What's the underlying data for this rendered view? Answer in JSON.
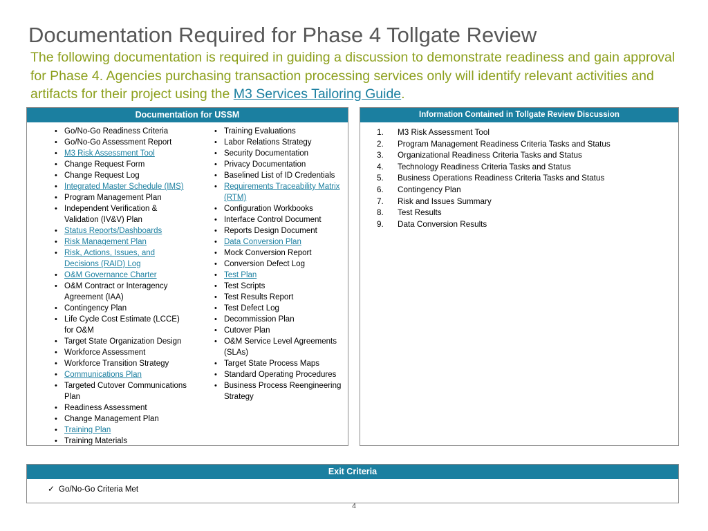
{
  "slide": {
    "title": "Documentation Required for Phase 4 Tollgate Review",
    "subtitle_part1": "The following documentation is required in guiding a discussion to demonstrate readiness and gain approval for Phase 4. Agencies purchasing transaction processing services only will identify relevant activities and artifacts for their project using the ",
    "subtitle_link": "M3 Services Tailoring Guide",
    "subtitle_part2": ".",
    "page_number": "4"
  },
  "left_panel": {
    "header": "Documentation for USSM",
    "column_a": [
      {
        "label": "Go/No-Go Readiness Criteria",
        "link": false
      },
      {
        "label": "Go/No-Go Assessment Report",
        "link": false
      },
      {
        "label": "M3 Risk Assessment Tool",
        "link": true
      },
      {
        "label": "Change Request Form",
        "link": false
      },
      {
        "label": "Change Request Log",
        "link": false
      },
      {
        "label": "Integrated Master Schedule (IMS)",
        "link": true
      },
      {
        "label": "Program Management Plan",
        "link": false
      },
      {
        "label": "Independent Verification & Validation (IV&V) Plan",
        "link": false
      },
      {
        "label": "Status Reports/Dashboards",
        "link": true
      },
      {
        "label": "Risk Management Plan",
        "link": true
      },
      {
        "label": "Risk, Actions, Issues, and Decisions (RAID) Log",
        "link": true
      },
      {
        "label": "O&M Governance Charter",
        "link": true
      },
      {
        "label": "O&M Contract or Interagency Agreement (IAA)",
        "link": false
      },
      {
        "label": "Contingency Plan",
        "link": false
      },
      {
        "label": "Life Cycle Cost Estimate (LCCE) for O&M",
        "link": false
      },
      {
        "label": "Target State Organization Design",
        "link": false
      },
      {
        "label": "Workforce Assessment",
        "link": false
      },
      {
        "label": "Workforce Transition Strategy",
        "link": false
      },
      {
        "label": "Communications Plan",
        "link": true
      },
      {
        "label": "Targeted Cutover Communications Plan",
        "link": false
      },
      {
        "label": "Readiness Assessment",
        "link": false
      },
      {
        "label": "Change Management Plan",
        "link": false
      },
      {
        "label": "Training Plan",
        "link": true
      },
      {
        "label": "Training Materials",
        "link": false
      }
    ],
    "column_b": [
      {
        "label": "Training Evaluations",
        "link": false
      },
      {
        "label": "Labor Relations Strategy",
        "link": false
      },
      {
        "label": "Security Documentation",
        "link": false
      },
      {
        "label": "Privacy Documentation",
        "link": false
      },
      {
        "label": "Baselined List of ID Credentials",
        "link": false
      },
      {
        "label": "Requirements Traceability Matrix (RTM)",
        "link": true
      },
      {
        "label": "Configuration Workbooks",
        "link": false
      },
      {
        "label": "Interface Control Document",
        "link": false
      },
      {
        "label": "Reports Design Document",
        "link": false
      },
      {
        "label": "Data Conversion Plan",
        "link": true
      },
      {
        "label": "Mock Conversion Report",
        "link": false
      },
      {
        "label": "Conversion Defect Log",
        "link": false
      },
      {
        "label": "Test Plan",
        "link": true
      },
      {
        "label": "Test Scripts",
        "link": false
      },
      {
        "label": "Test Results Report",
        "link": false
      },
      {
        "label": "Test Defect Log",
        "link": false
      },
      {
        "label": "Decommission Plan",
        "link": false
      },
      {
        "label": "Cutover Plan",
        "link": false
      },
      {
        "label": "O&M Service Level Agreements (SLAs)",
        "link": false
      },
      {
        "label": "Target State Process Maps",
        "link": false
      },
      {
        "label": "Standard Operating Procedures",
        "link": false
      },
      {
        "label": "Business Process Reengineering Strategy",
        "link": false
      }
    ]
  },
  "right_panel": {
    "header": "Information Contained in Tollgate Review Discussion",
    "items": [
      {
        "num": "1.",
        "label": "M3 Risk Assessment Tool"
      },
      {
        "num": "2.",
        "label": "Program Management Readiness Criteria Tasks and Status"
      },
      {
        "num": "3.",
        "label": "Organizational Readiness Criteria Tasks and Status"
      },
      {
        "num": "4.",
        "label": "Technology Readiness Criteria Tasks and Status"
      },
      {
        "num": "5.",
        "label": "Business Operations Readiness Criteria Tasks and Status"
      },
      {
        "num": "6.",
        "label": "Contingency Plan"
      },
      {
        "num": "7.",
        "label": "Risk and Issues Summary"
      },
      {
        "num": "8.",
        "label": "Test Results"
      },
      {
        "num": "9.",
        "label": "Data Conversion Results"
      }
    ]
  },
  "exit_panel": {
    "header": "Exit Criteria",
    "check_glyph": "✓",
    "items": [
      {
        "label": "Go/No-Go Criteria Met"
      }
    ]
  },
  "colors": {
    "header_bg": "#1b7fa0",
    "title_gray": "#575757",
    "subtitle_green": "#8c9f1c",
    "link_blue": "#1b7fa0"
  }
}
